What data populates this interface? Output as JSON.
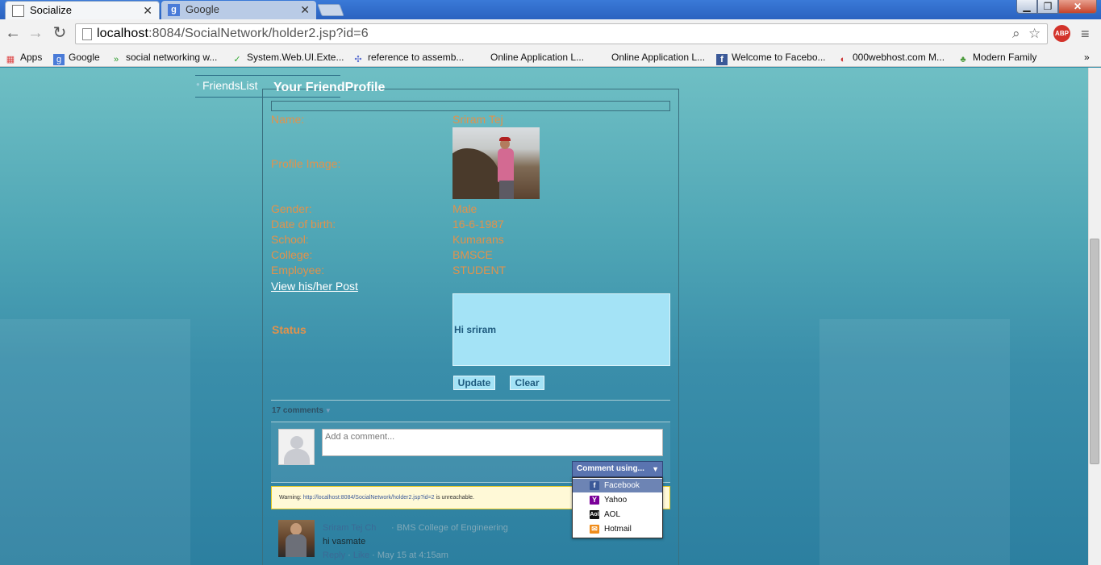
{
  "browser": {
    "tabs": [
      {
        "title": "Socialize",
        "icon": "socialize-favicon"
      },
      {
        "title": "Google",
        "icon": "google-favicon"
      }
    ],
    "url_host": "localhost",
    "url_rest": ":8084/SocialNetwork/holder2.jsp?id=6",
    "abp_label": "ABP",
    "bookmarks": [
      {
        "label": "Apps",
        "icon": "apps-grid-icon"
      },
      {
        "label": "Google",
        "icon": "google-icon"
      },
      {
        "label": "social networking w...",
        "icon": "green-arrow-icon"
      },
      {
        "label": "System.Web.UI.Exte...",
        "icon": "checkmark-icon"
      },
      {
        "label": "reference to assemb...",
        "icon": "visual-studio-icon"
      },
      {
        "label": "Online Application L...",
        "icon": ""
      },
      {
        "label": "Online Application L...",
        "icon": ""
      },
      {
        "label": "Welcome to Facebo...",
        "icon": "facebook-icon"
      },
      {
        "label": "000webhost.com M...",
        "icon": "webhost-icon"
      },
      {
        "label": "Modern Family",
        "icon": "tree-icon"
      }
    ],
    "bookmarks_overflow": "»"
  },
  "sidebar": {
    "friends_list": "FriendsList"
  },
  "profile": {
    "legend": "Your FriendProfile",
    "labels": {
      "name": "Name:",
      "image": "Profile Image:",
      "gender": "Gender:",
      "dob": "Date of birth:",
      "school": "School:",
      "college": "College:",
      "employee": "Employee:"
    },
    "values": {
      "name": "Sriram Tej",
      "gender": "Male",
      "dob": "16-6-1987",
      "school": "Kumarans",
      "college": "BMSCE",
      "employee": "STUDENT"
    },
    "view_post_link": "View his/her Post",
    "status_label": "Status",
    "status_text": "Hi sriram",
    "update_button": "Update",
    "clear_button": "Clear"
  },
  "comments": {
    "count_label": "17 comments",
    "input_placeholder": "Add a comment...",
    "comment_using": "Comment using...",
    "providers": [
      {
        "label": "Facebook",
        "icon": "facebook-icon",
        "color": "#3b5998"
      },
      {
        "label": "Yahoo",
        "icon": "yahoo-icon",
        "color": "#7b0099"
      },
      {
        "label": "AOL",
        "icon": "aol-icon",
        "color": "#111111"
      },
      {
        "label": "Hotmail",
        "icon": "hotmail-icon",
        "color": "#f08c1a"
      }
    ],
    "warning_prefix": "Warning: ",
    "warning_link": "http://localhost:8084/SocialNetwork/holder2.jsp?id=2",
    "warning_suffix": " is unreachable.",
    "first_comment": {
      "author": "Sriram Tej Ch",
      "org": "· BMS College of Engineering",
      "text": "hi vasmate",
      "reply": "Reply",
      "like": "Like",
      "date": "· May 15 at 4:15am"
    }
  },
  "colors": {
    "label_orange": "#e2924b",
    "status_box": "#a4e3f6",
    "facebook_blue": "#6d84b4"
  }
}
